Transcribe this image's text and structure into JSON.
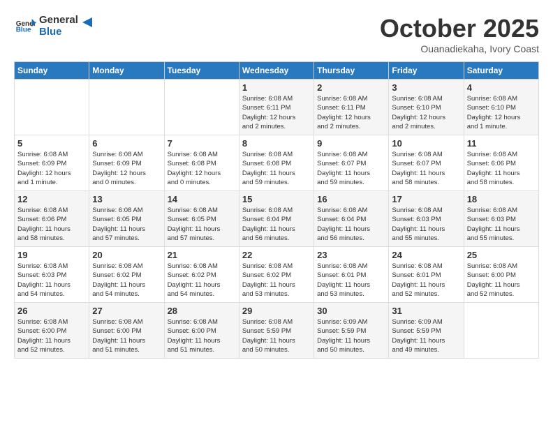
{
  "header": {
    "logo_line1": "General",
    "logo_line2": "Blue",
    "month_title": "October 2025",
    "subtitle": "Ouanadiekaha, Ivory Coast"
  },
  "days_of_week": [
    "Sunday",
    "Monday",
    "Tuesday",
    "Wednesday",
    "Thursday",
    "Friday",
    "Saturday"
  ],
  "weeks": [
    [
      {
        "day": "",
        "info": ""
      },
      {
        "day": "",
        "info": ""
      },
      {
        "day": "",
        "info": ""
      },
      {
        "day": "1",
        "info": "Sunrise: 6:08 AM\nSunset: 6:11 PM\nDaylight: 12 hours\nand 2 minutes."
      },
      {
        "day": "2",
        "info": "Sunrise: 6:08 AM\nSunset: 6:11 PM\nDaylight: 12 hours\nand 2 minutes."
      },
      {
        "day": "3",
        "info": "Sunrise: 6:08 AM\nSunset: 6:10 PM\nDaylight: 12 hours\nand 2 minutes."
      },
      {
        "day": "4",
        "info": "Sunrise: 6:08 AM\nSunset: 6:10 PM\nDaylight: 12 hours\nand 1 minute."
      }
    ],
    [
      {
        "day": "5",
        "info": "Sunrise: 6:08 AM\nSunset: 6:09 PM\nDaylight: 12 hours\nand 1 minute."
      },
      {
        "day": "6",
        "info": "Sunrise: 6:08 AM\nSunset: 6:09 PM\nDaylight: 12 hours\nand 0 minutes."
      },
      {
        "day": "7",
        "info": "Sunrise: 6:08 AM\nSunset: 6:08 PM\nDaylight: 12 hours\nand 0 minutes."
      },
      {
        "day": "8",
        "info": "Sunrise: 6:08 AM\nSunset: 6:08 PM\nDaylight: 11 hours\nand 59 minutes."
      },
      {
        "day": "9",
        "info": "Sunrise: 6:08 AM\nSunset: 6:07 PM\nDaylight: 11 hours\nand 59 minutes."
      },
      {
        "day": "10",
        "info": "Sunrise: 6:08 AM\nSunset: 6:07 PM\nDaylight: 11 hours\nand 58 minutes."
      },
      {
        "day": "11",
        "info": "Sunrise: 6:08 AM\nSunset: 6:06 PM\nDaylight: 11 hours\nand 58 minutes."
      }
    ],
    [
      {
        "day": "12",
        "info": "Sunrise: 6:08 AM\nSunset: 6:06 PM\nDaylight: 11 hours\nand 58 minutes."
      },
      {
        "day": "13",
        "info": "Sunrise: 6:08 AM\nSunset: 6:05 PM\nDaylight: 11 hours\nand 57 minutes."
      },
      {
        "day": "14",
        "info": "Sunrise: 6:08 AM\nSunset: 6:05 PM\nDaylight: 11 hours\nand 57 minutes."
      },
      {
        "day": "15",
        "info": "Sunrise: 6:08 AM\nSunset: 6:04 PM\nDaylight: 11 hours\nand 56 minutes."
      },
      {
        "day": "16",
        "info": "Sunrise: 6:08 AM\nSunset: 6:04 PM\nDaylight: 11 hours\nand 56 minutes."
      },
      {
        "day": "17",
        "info": "Sunrise: 6:08 AM\nSunset: 6:03 PM\nDaylight: 11 hours\nand 55 minutes."
      },
      {
        "day": "18",
        "info": "Sunrise: 6:08 AM\nSunset: 6:03 PM\nDaylight: 11 hours\nand 55 minutes."
      }
    ],
    [
      {
        "day": "19",
        "info": "Sunrise: 6:08 AM\nSunset: 6:03 PM\nDaylight: 11 hours\nand 54 minutes."
      },
      {
        "day": "20",
        "info": "Sunrise: 6:08 AM\nSunset: 6:02 PM\nDaylight: 11 hours\nand 54 minutes."
      },
      {
        "day": "21",
        "info": "Sunrise: 6:08 AM\nSunset: 6:02 PM\nDaylight: 11 hours\nand 54 minutes."
      },
      {
        "day": "22",
        "info": "Sunrise: 6:08 AM\nSunset: 6:02 PM\nDaylight: 11 hours\nand 53 minutes."
      },
      {
        "day": "23",
        "info": "Sunrise: 6:08 AM\nSunset: 6:01 PM\nDaylight: 11 hours\nand 53 minutes."
      },
      {
        "day": "24",
        "info": "Sunrise: 6:08 AM\nSunset: 6:01 PM\nDaylight: 11 hours\nand 52 minutes."
      },
      {
        "day": "25",
        "info": "Sunrise: 6:08 AM\nSunset: 6:00 PM\nDaylight: 11 hours\nand 52 minutes."
      }
    ],
    [
      {
        "day": "26",
        "info": "Sunrise: 6:08 AM\nSunset: 6:00 PM\nDaylight: 11 hours\nand 52 minutes."
      },
      {
        "day": "27",
        "info": "Sunrise: 6:08 AM\nSunset: 6:00 PM\nDaylight: 11 hours\nand 51 minutes."
      },
      {
        "day": "28",
        "info": "Sunrise: 6:08 AM\nSunset: 6:00 PM\nDaylight: 11 hours\nand 51 minutes."
      },
      {
        "day": "29",
        "info": "Sunrise: 6:08 AM\nSunset: 5:59 PM\nDaylight: 11 hours\nand 50 minutes."
      },
      {
        "day": "30",
        "info": "Sunrise: 6:09 AM\nSunset: 5:59 PM\nDaylight: 11 hours\nand 50 minutes."
      },
      {
        "day": "31",
        "info": "Sunrise: 6:09 AM\nSunset: 5:59 PM\nDaylight: 11 hours\nand 49 minutes."
      },
      {
        "day": "",
        "info": ""
      }
    ]
  ]
}
